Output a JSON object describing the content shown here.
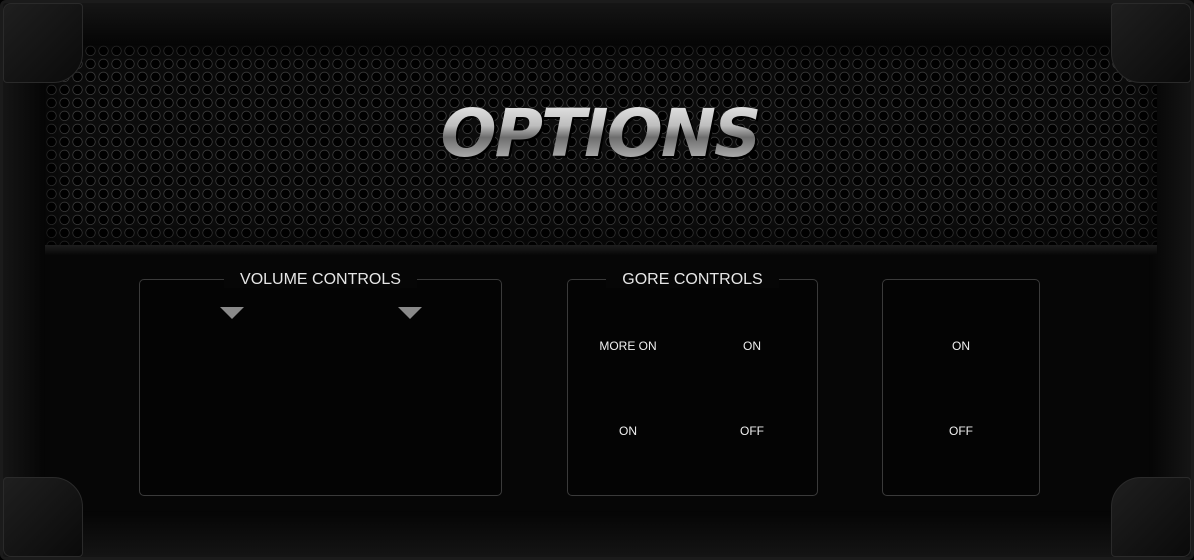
{
  "title": "OPTIONS",
  "volume": {
    "label": "VOLUME CONTROLS",
    "slider_icons": [
      "triangle-down-icon",
      "triangle-down-icon"
    ]
  },
  "gore": {
    "label": "GORE CONTROLS",
    "options": [
      "MORE ON",
      "ON",
      "ON",
      "OFF"
    ]
  },
  "extra": {
    "options": [
      "ON",
      "OFF"
    ]
  },
  "colors": {
    "background": "#060606",
    "text": "#f0f0f0",
    "border": "#3a3a3a"
  }
}
